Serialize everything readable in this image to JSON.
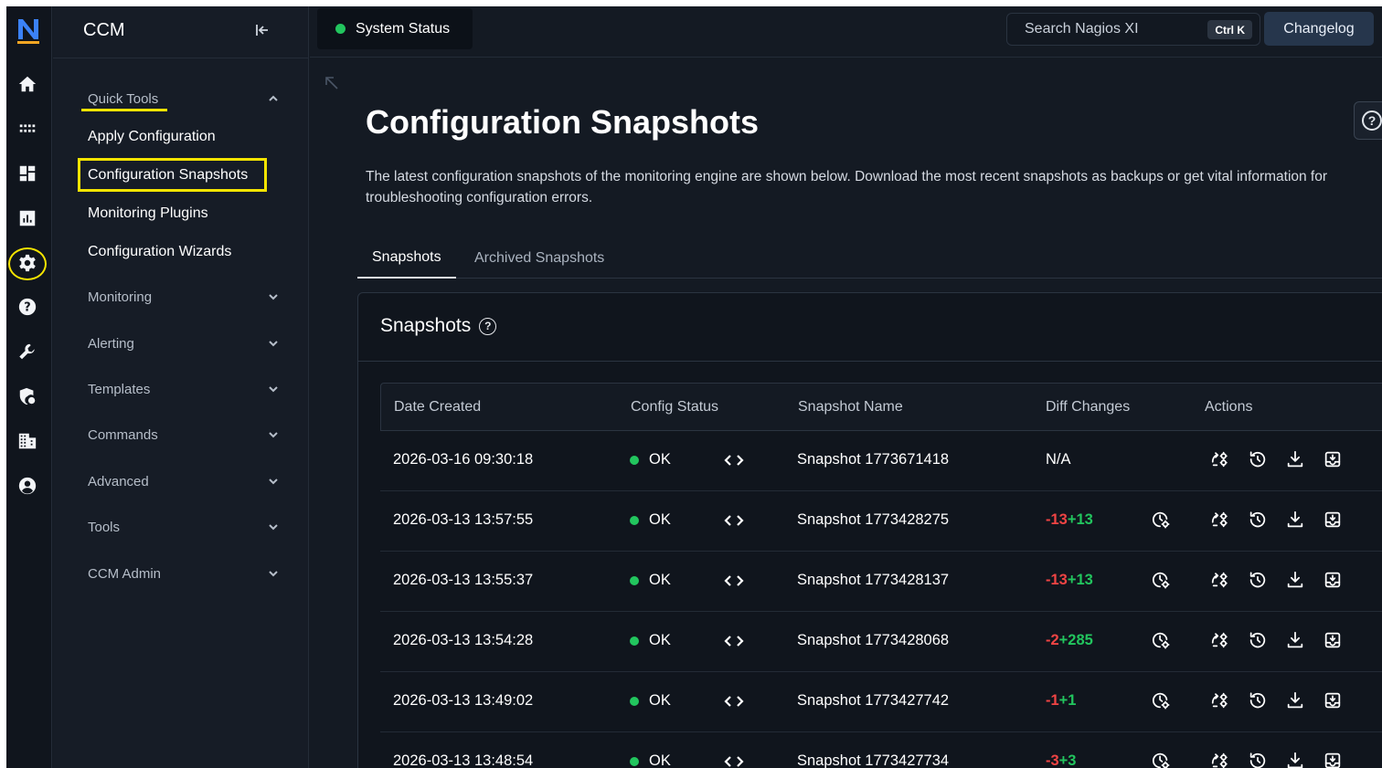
{
  "rail": {
    "items": [
      "home-icon",
      "apps-grid-icon",
      "dashboard-icon",
      "reports-icon",
      "gear-icon",
      "help-icon",
      "wrench-icon",
      "security-icon",
      "building-icon",
      "account-icon"
    ],
    "selected": "gear-icon"
  },
  "sidebar": {
    "title": "CCM",
    "quick_tools": {
      "label": "Quick Tools",
      "items": [
        "Apply Configuration",
        "Configuration Snapshots",
        "Monitoring Plugins",
        "Configuration Wizards"
      ],
      "selected": "Configuration Snapshots"
    },
    "groups": [
      "Monitoring",
      "Alerting",
      "Templates",
      "Commands",
      "Advanced",
      "Tools",
      "CCM Admin"
    ]
  },
  "topbar": {
    "system_status": "System Status",
    "search_placeholder": "Search Nagios XI",
    "search_shortcut": "Ctrl K",
    "changelog": "Changelog"
  },
  "main": {
    "title": "Configuration Snapshots",
    "description": "The latest configuration snapshots of the monitoring engine are shown below. Download the most recent snapshots as backups or get vital information for troubleshooting configuration errors.",
    "tabs": [
      "Snapshots",
      "Archived Snapshots"
    ],
    "active_tab": "Snapshots",
    "card_title": "Snapshots"
  },
  "table": {
    "headers": [
      "Date Created",
      "Config Status",
      "Snapshot Name",
      "Diff Changes",
      "Actions"
    ],
    "rows": [
      {
        "date": "2026-03-16 09:30:18",
        "status": "OK",
        "name": "Snapshot 1773671418",
        "diff_na": "N/A",
        "removed": "",
        "added": ""
      },
      {
        "date": "2026-03-13 13:57:55",
        "status": "OK",
        "name": "Snapshot 1773428275",
        "diff_na": "",
        "removed": "-13",
        "added": "+13"
      },
      {
        "date": "2026-03-13 13:55:37",
        "status": "OK",
        "name": "Snapshot 1773428137",
        "diff_na": "",
        "removed": "-13",
        "added": "+13"
      },
      {
        "date": "2026-03-13 13:54:28",
        "status": "OK",
        "name": "Snapshot 1773428068",
        "diff_na": "",
        "removed": "-2",
        "added": "+285"
      },
      {
        "date": "2026-03-13 13:49:02",
        "status": "OK",
        "name": "Snapshot 1773427742",
        "diff_na": "",
        "removed": "-1",
        "added": "+1"
      },
      {
        "date": "2026-03-13 13:48:54",
        "status": "OK",
        "name": "Snapshot 1773427734",
        "diff_na": "",
        "removed": "-3",
        "added": "+3"
      }
    ]
  },
  "colors": {
    "status_ok": "#22c55e",
    "diff_removed": "#ef4444",
    "diff_added": "#22c55e",
    "highlight": "#f5e400"
  }
}
